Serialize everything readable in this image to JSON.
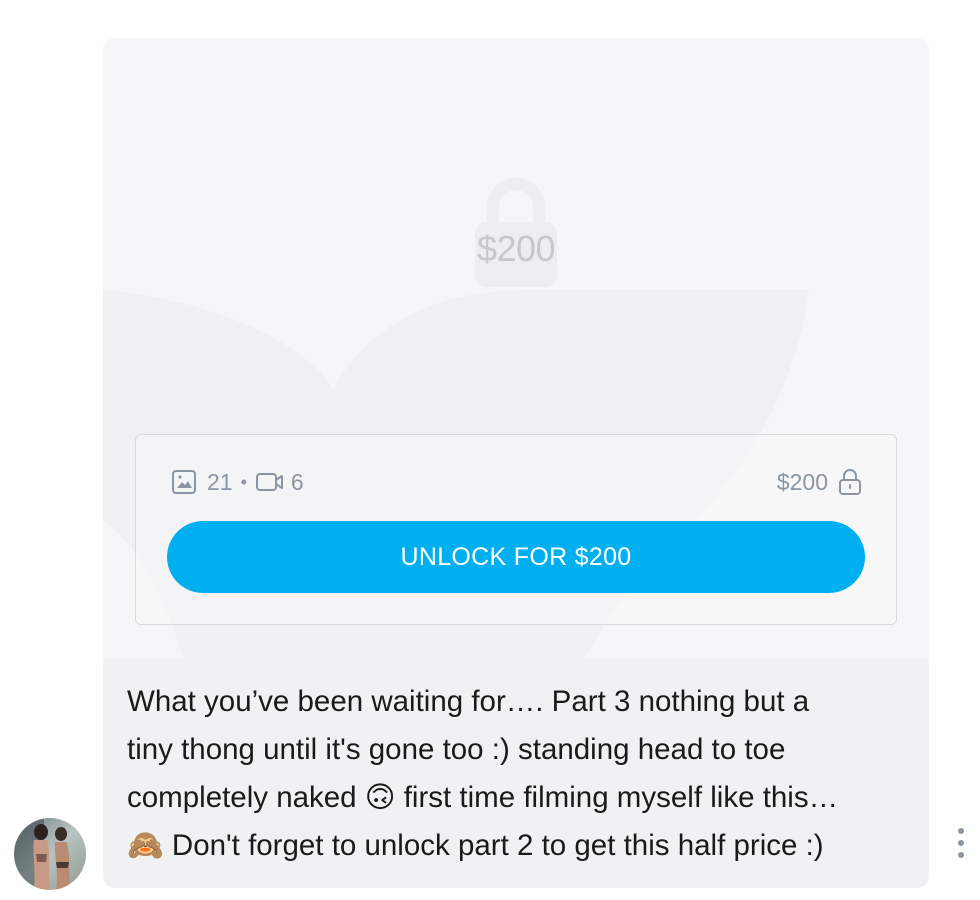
{
  "post": {
    "media": {
      "locked_price_overlay": "$200",
      "photo_count": "21",
      "separator": "•",
      "video_count": "6",
      "price": "$200",
      "unlock_button_label": "UNLOCK FOR $200"
    },
    "caption_lines": [
      "What you’ve been waiting for…. Part 3 nothing but a",
      "tiny thong until it's gone too :) standing head to toe",
      "completely naked 🙃 first time filming myself like this…",
      "🙈 Don't forget to unlock part 2 to get this half price :)"
    ]
  },
  "colors": {
    "accent": "#00aff0",
    "muted_text": "#8a96a3",
    "card_bg": "#f5f6f7",
    "caption_bg": "#f0f1f2"
  },
  "icons": {
    "photo": "image-icon",
    "video": "video-camera-icon",
    "lock": "lock-icon",
    "more": "more-vertical-icon"
  }
}
